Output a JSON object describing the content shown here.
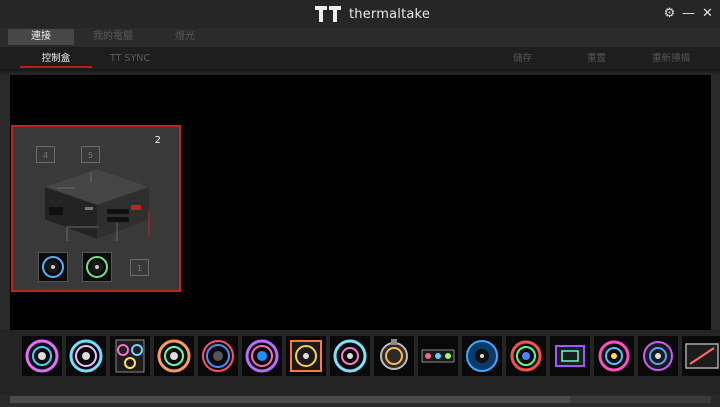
{
  "app": {
    "brand": "thermaltake"
  },
  "window_controls": {
    "settings": "⚙",
    "minimize": "—",
    "close": "✕"
  },
  "nav_primary": [
    {
      "label": "連接",
      "active": true
    },
    {
      "label": "我的電腦",
      "active": false
    },
    {
      "label": "燈光",
      "active": false
    }
  ],
  "nav_secondary": [
    {
      "label": "控制盒",
      "active": true
    },
    {
      "label": "TT SYNC",
      "active": false
    }
  ],
  "actions": {
    "save": "儲存",
    "reset": "重置",
    "rescan": "重新掃描"
  },
  "controller": {
    "number": "2",
    "ports": [
      "4",
      "5",
      "1"
    ]
  },
  "device_tray": {
    "items": [
      "riing-quad-fan-icon",
      "riing-trio-fan-icon",
      "triple-fan-kit-icon",
      "riing-plus-fan-icon",
      "pure-plus-fan-icon",
      "riing-duo-fan-icon",
      "square-fan-icon",
      "ring-fan-icon",
      "pump-icon",
      "led-strip-icon",
      "water-block-icon",
      "cpu-block-icon",
      "gpu-block-icon",
      "reservoir-icon",
      "pacific-block-icon",
      "panel-icon"
    ]
  },
  "colors": {
    "accent": "#c32222",
    "canvas": "#000000"
  }
}
